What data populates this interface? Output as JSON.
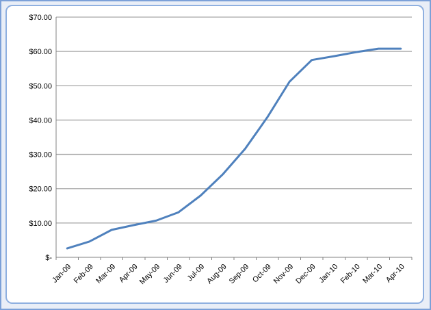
{
  "chart_data": {
    "type": "line",
    "title": "",
    "xlabel": "",
    "ylabel": "",
    "categories": [
      "Jan-09",
      "Feb-09",
      "Mar-09",
      "Apr-09",
      "May-09",
      "Jun-09",
      "Jul-09",
      "Aug-09",
      "Sep-09",
      "Oct-09",
      "Nov-09",
      "Dec-09",
      "Jan-10",
      "Feb-10",
      "Mar-10",
      "Apr-10"
    ],
    "series": [
      {
        "name": "Series1",
        "color": "#4f81bd",
        "values": [
          2.6,
          4.6,
          8.0,
          9.4,
          10.7,
          13.1,
          18.0,
          24.2,
          31.6,
          40.8,
          51.2,
          57.5,
          58.6,
          59.8,
          60.8,
          60.8
        ]
      }
    ],
    "ylim": [
      0,
      70
    ],
    "yticks": [
      0,
      10,
      20,
      30,
      40,
      50,
      60,
      70
    ],
    "ytick_labels": [
      "$-",
      "$10.00",
      "$20.00",
      "$30.00",
      "$40.00",
      "$50.00",
      "$60.00",
      "$70.00"
    ],
    "grid": true,
    "legend": "none"
  }
}
